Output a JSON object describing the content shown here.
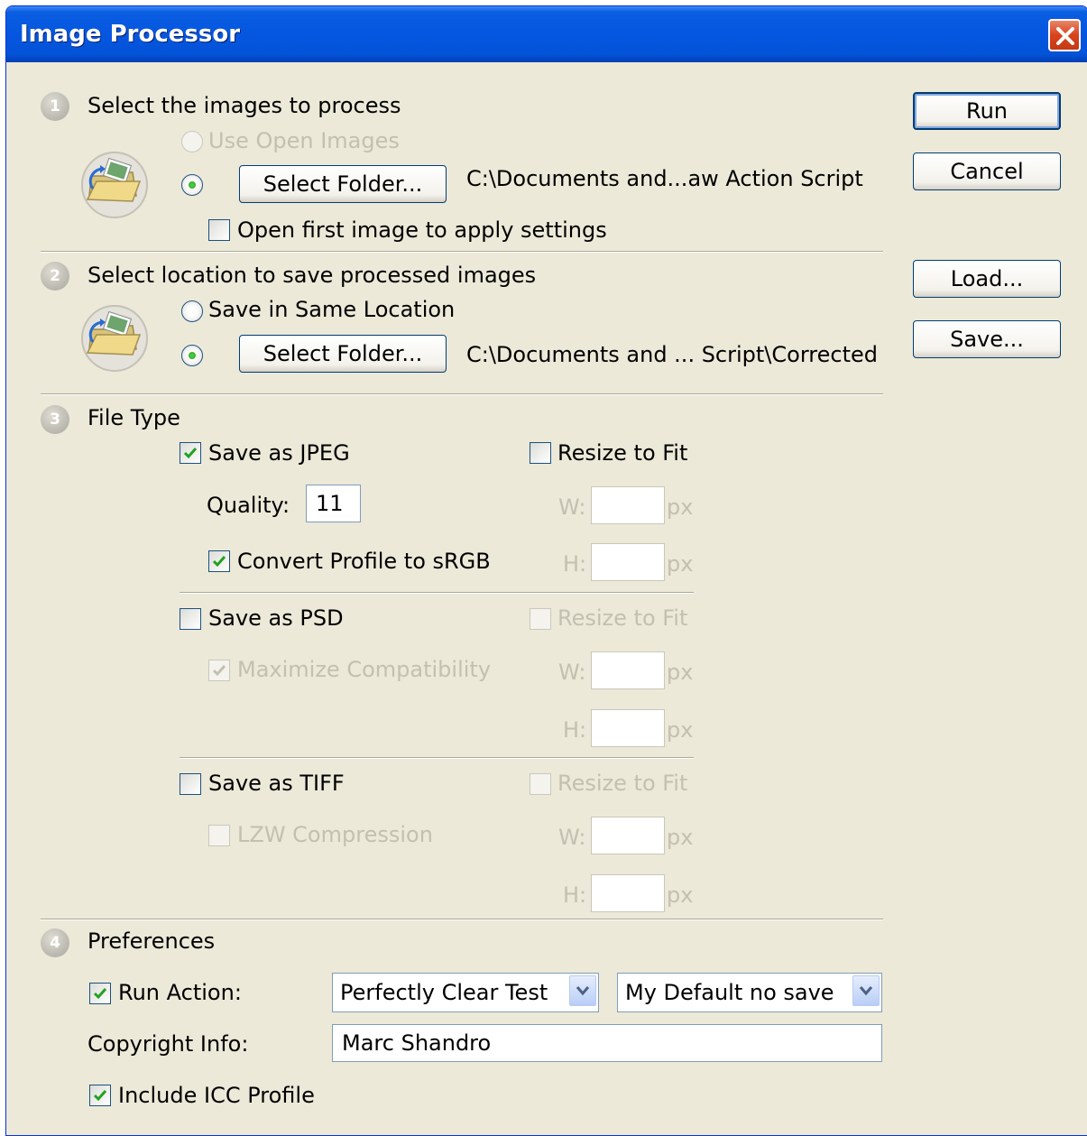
{
  "window": {
    "title": "Image Processor"
  },
  "colors": {
    "titlebar": "#0556e0",
    "dialog_bg": "#ece9d8",
    "close_button": "#d8431c",
    "check": "#21a121"
  },
  "section1": {
    "number": "1",
    "heading": "Select the images to process",
    "use_open_images": "Use Open Images",
    "select_folder_button": "Select Folder...",
    "folder_path": "C:\\Documents and...aw Action Script",
    "open_first_image": "Open first image to apply settings"
  },
  "section2": {
    "number": "2",
    "heading": "Select location to save processed images",
    "save_same_location": "Save in Same Location",
    "select_folder_button": "Select Folder...",
    "folder_path": "C:\\Documents and ... Script\\Corrected"
  },
  "section3": {
    "number": "3",
    "heading": "File Type",
    "jpeg": {
      "save_label": "Save as JPEG",
      "save_checked": true,
      "resize_label": "Resize to Fit",
      "quality_label": "Quality:",
      "quality_value": "11",
      "convert_profile": "Convert Profile to sRGB",
      "w_label": "W:",
      "h_label": "H:",
      "unit": "px"
    },
    "psd": {
      "save_label": "Save as PSD",
      "resize_label": "Resize to Fit",
      "maximize": "Maximize Compatibility",
      "w_label": "W:",
      "h_label": "H:",
      "unit": "px"
    },
    "tiff": {
      "save_label": "Save as TIFF",
      "resize_label": "Resize to Fit",
      "lzw": "LZW Compression",
      "w_label": "W:",
      "h_label": "H:",
      "unit": "px"
    }
  },
  "section4": {
    "number": "4",
    "heading": "Preferences",
    "run_action_label": "Run Action:",
    "action_set": "Perfectly Clear Test",
    "action": "My Default no save",
    "copyright_label": "Copyright Info:",
    "copyright_value": "Marc Shandro",
    "include_icc": "Include ICC Profile"
  },
  "buttons": {
    "run": "Run",
    "cancel": "Cancel",
    "load": "Load...",
    "save": "Save..."
  },
  "icons": {
    "close": "close-icon",
    "folder": "folder-photo-icon",
    "dropdown": "chevron-down-icon",
    "check": "checkmark-icon"
  }
}
